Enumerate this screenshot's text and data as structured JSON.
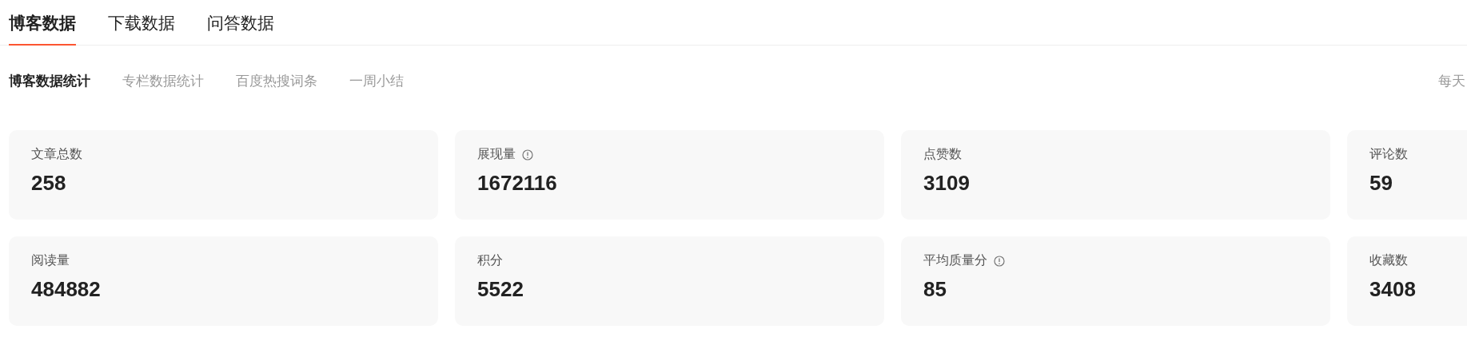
{
  "tabs": [
    {
      "label": "博客数据",
      "selected": true
    },
    {
      "label": "下载数据",
      "selected": false
    },
    {
      "label": "问答数据",
      "selected": false
    }
  ],
  "subtabs": [
    {
      "label": "博客数据统计",
      "selected": true
    },
    {
      "label": "专栏数据统计",
      "selected": false
    },
    {
      "label": "百度热搜词条",
      "selected": false
    },
    {
      "label": "一周小结",
      "selected": false
    }
  ],
  "update_note": "每天",
  "stats": [
    {
      "label": "文章总数",
      "value": "258",
      "info": false
    },
    {
      "label": "展现量",
      "value": "1672116",
      "info": true
    },
    {
      "label": "点赞数",
      "value": "3109",
      "info": false
    },
    {
      "label": "评论数",
      "value": "59",
      "info": false
    },
    {
      "label": "阅读量",
      "value": "484882",
      "info": false
    },
    {
      "label": "积分",
      "value": "5522",
      "info": false
    },
    {
      "label": "平均质量分",
      "value": "85",
      "info": true
    },
    {
      "label": "收藏数",
      "value": "3408",
      "info": false
    }
  ]
}
